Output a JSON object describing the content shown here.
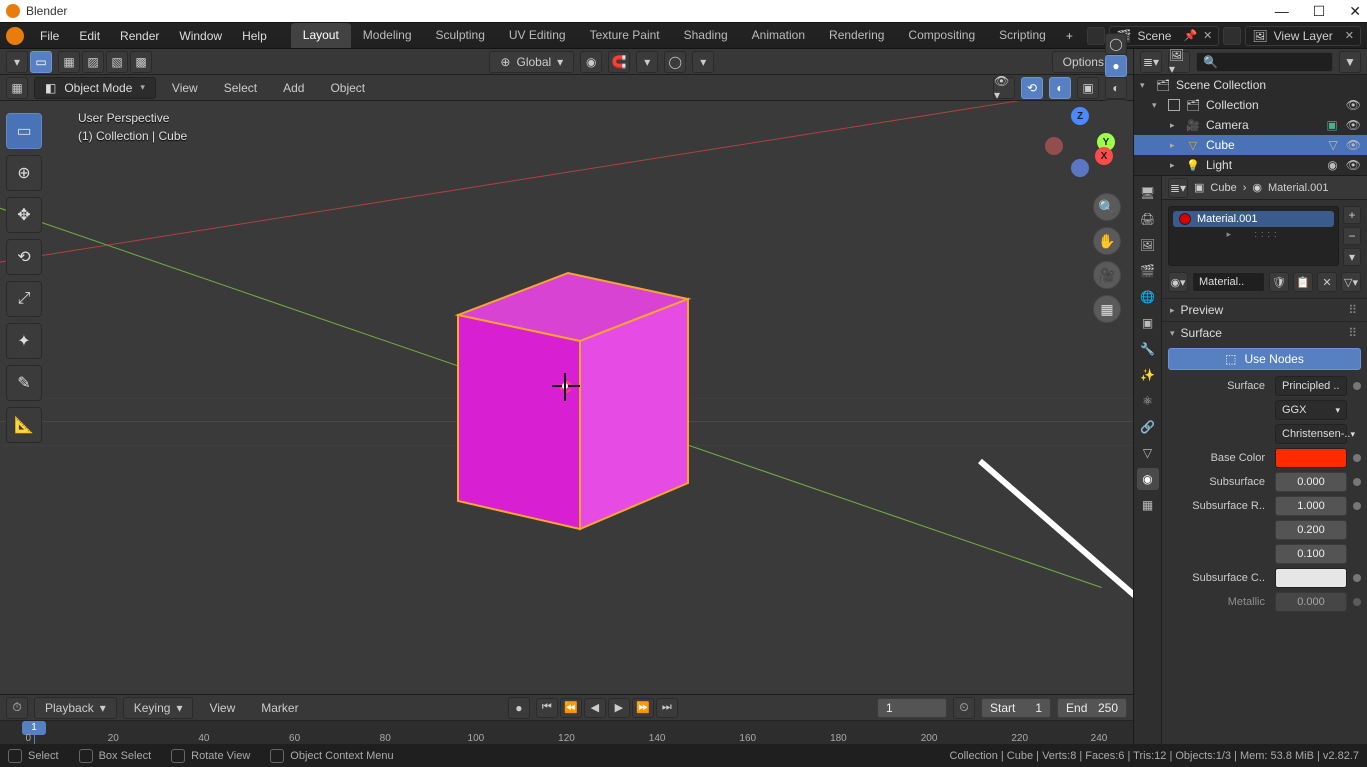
{
  "title_bar": {
    "app_name": "Blender"
  },
  "main_menu": [
    "File",
    "Edit",
    "Render",
    "Window",
    "Help"
  ],
  "workspaces": {
    "tabs": [
      "Layout",
      "Modeling",
      "Sculpting",
      "UV Editing",
      "Texture Paint",
      "Shading",
      "Animation",
      "Rendering",
      "Compositing",
      "Scripting"
    ],
    "active": "Layout"
  },
  "scene_selector": {
    "label": "Scene"
  },
  "view_layer_selector": {
    "label": "View Layer"
  },
  "viewport_header": {
    "options_label": "Options",
    "global_label": "Global"
  },
  "viewport_header2": {
    "mode": "Object Mode",
    "menus": [
      "View",
      "Select",
      "Add",
      "Object"
    ]
  },
  "viewport_overlay": {
    "line1": "User Perspective",
    "line2": "(1) Collection | Cube"
  },
  "timeline": {
    "playback_label": "Playback",
    "keying_label": "Keying",
    "view_label": "View",
    "marker_label": "Marker",
    "current_frame": "1",
    "start_label": "Start",
    "start": "1",
    "end_label": "End",
    "end": "250",
    "ticks": [
      "0",
      "20",
      "40",
      "60",
      "80",
      "100",
      "120",
      "140",
      "160",
      "180",
      "200",
      "220",
      "240"
    ]
  },
  "statusbar": {
    "select": "Select",
    "box_select": "Box Select",
    "rotate": "Rotate View",
    "context": "Object Context Menu",
    "info": "Collection | Cube | Verts:8 | Faces:6 | Tris:12 | Objects:1/3 | Mem: 53.8 MiB | v2.82.7"
  },
  "outliner": {
    "scene_collection": "Scene Collection",
    "collection": "Collection",
    "items": [
      {
        "name": "Camera",
        "icon": "camera"
      },
      {
        "name": "Cube",
        "icon": "mesh",
        "active": true
      },
      {
        "name": "Light",
        "icon": "light"
      }
    ]
  },
  "properties": {
    "breadcrumb_object": "Cube",
    "breadcrumb_material": "Material.001",
    "slot_material": "Material.001",
    "material_name": "Material..",
    "preview_panel": "Preview",
    "surface_panel": "Surface",
    "use_nodes": "Use Nodes",
    "surface_label": "Surface",
    "surface_value": "Principled ..",
    "dist_value": "GGX",
    "sss_method": "Christensen-..",
    "base_color_label": "Base Color",
    "base_color_hex": "#ff2a00",
    "subsurface_label": "Subsurface",
    "subsurface_value": "0.000",
    "subsurface_radius_label": "Subsurface R..",
    "subsurface_radius": [
      "1.000",
      "0.200",
      "0.100"
    ],
    "subsurface_color_label": "Subsurface C..",
    "subsurface_color_hex": "#e6e6e6",
    "metallic_label": "Metallic",
    "metallic_value": "0.000"
  }
}
